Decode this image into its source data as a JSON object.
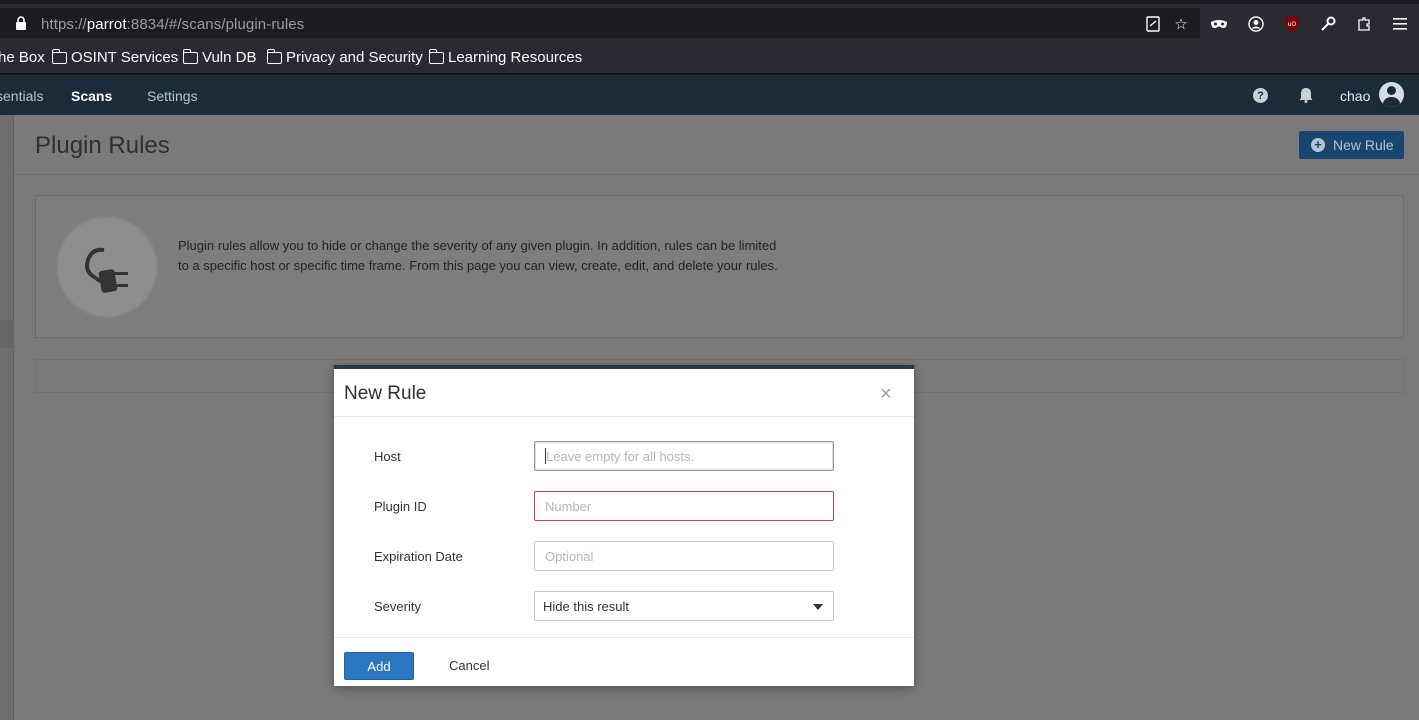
{
  "browser": {
    "url_prefix": "https://",
    "url_host": "parrot",
    "url_rest": ":8834/#/scans/plugin-rules"
  },
  "bookmarks": [
    {
      "label": "he Box"
    },
    {
      "label": "OSINT Services"
    },
    {
      "label": "Vuln DB"
    },
    {
      "label": "Privacy and Security"
    },
    {
      "label": "Learning Resources"
    }
  ],
  "appnav": {
    "items": [
      {
        "label": "sentials"
      },
      {
        "label": "Scans"
      },
      {
        "label": "Settings"
      }
    ],
    "user": "chao"
  },
  "page": {
    "title": "Plugin Rules",
    "new_rule_label": "New Rule",
    "info_text": "Plugin rules allow you to hide or change the severity of any given plugin. In addition, rules can be limited to a specific host or specific time frame. From this page you can view, create, edit, and delete your rules."
  },
  "modal": {
    "title": "New Rule",
    "close": "×",
    "fields": {
      "host_label": "Host",
      "host_placeholder": "Leave empty for all hosts.",
      "plugin_id_label": "Plugin ID",
      "plugin_id_placeholder": "Number",
      "expiration_label": "Expiration Date",
      "expiration_placeholder": "Optional",
      "severity_label": "Severity",
      "severity_value": "Hide this result"
    },
    "add_label": "Add",
    "cancel_label": "Cancel"
  }
}
